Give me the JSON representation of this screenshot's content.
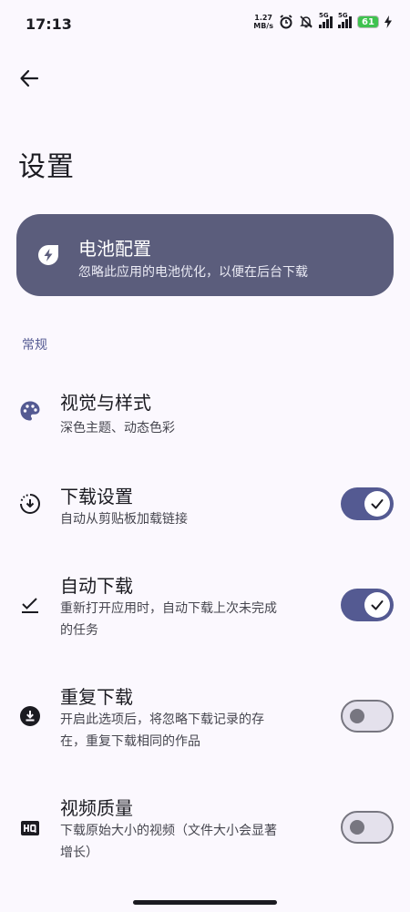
{
  "status_bar": {
    "time": "17:13",
    "net_speed_value": "1.27",
    "net_speed_unit": "MB/s",
    "signal_1_label": "5G",
    "signal_2_label": "5G",
    "battery_level": "61"
  },
  "header": {
    "title": "设置"
  },
  "battery_card": {
    "title": "电池配置",
    "subtitle": "忽略此应用的电池优化，以便在后台下载",
    "icon": "battery-bolt-icon"
  },
  "section": {
    "label": "常规"
  },
  "settings": [
    {
      "title": "视觉与样式",
      "subtitle": "深色主题、动态色彩",
      "icon": "palette-icon"
    },
    {
      "title": "下载设置",
      "subtitle": "自动从剪贴板加载链接",
      "icon": "download-circle-icon",
      "toggle": "on"
    },
    {
      "title": "自动下载",
      "subtitle_line1": "重新打开应用时，自动下载上次未完成",
      "subtitle_line2": "的任务",
      "icon": "done-download-icon",
      "toggle": "on"
    },
    {
      "title": "重复下载",
      "subtitle_line1": "开启此选项后，将忽略下载记录的存",
      "subtitle_line2": "在，重复下载相同的作品",
      "icon": "download-filled-icon",
      "toggle": "off"
    },
    {
      "title": "视频质量",
      "subtitle_line1": "下载原始大小的视频（文件大小会显著",
      "subtitle_line2": "增长）",
      "icon": "hq-icon",
      "toggle": "off"
    }
  ],
  "colors": {
    "background": "#fbf8fe",
    "card": "#5b5d7c",
    "accent": "#545a92"
  }
}
